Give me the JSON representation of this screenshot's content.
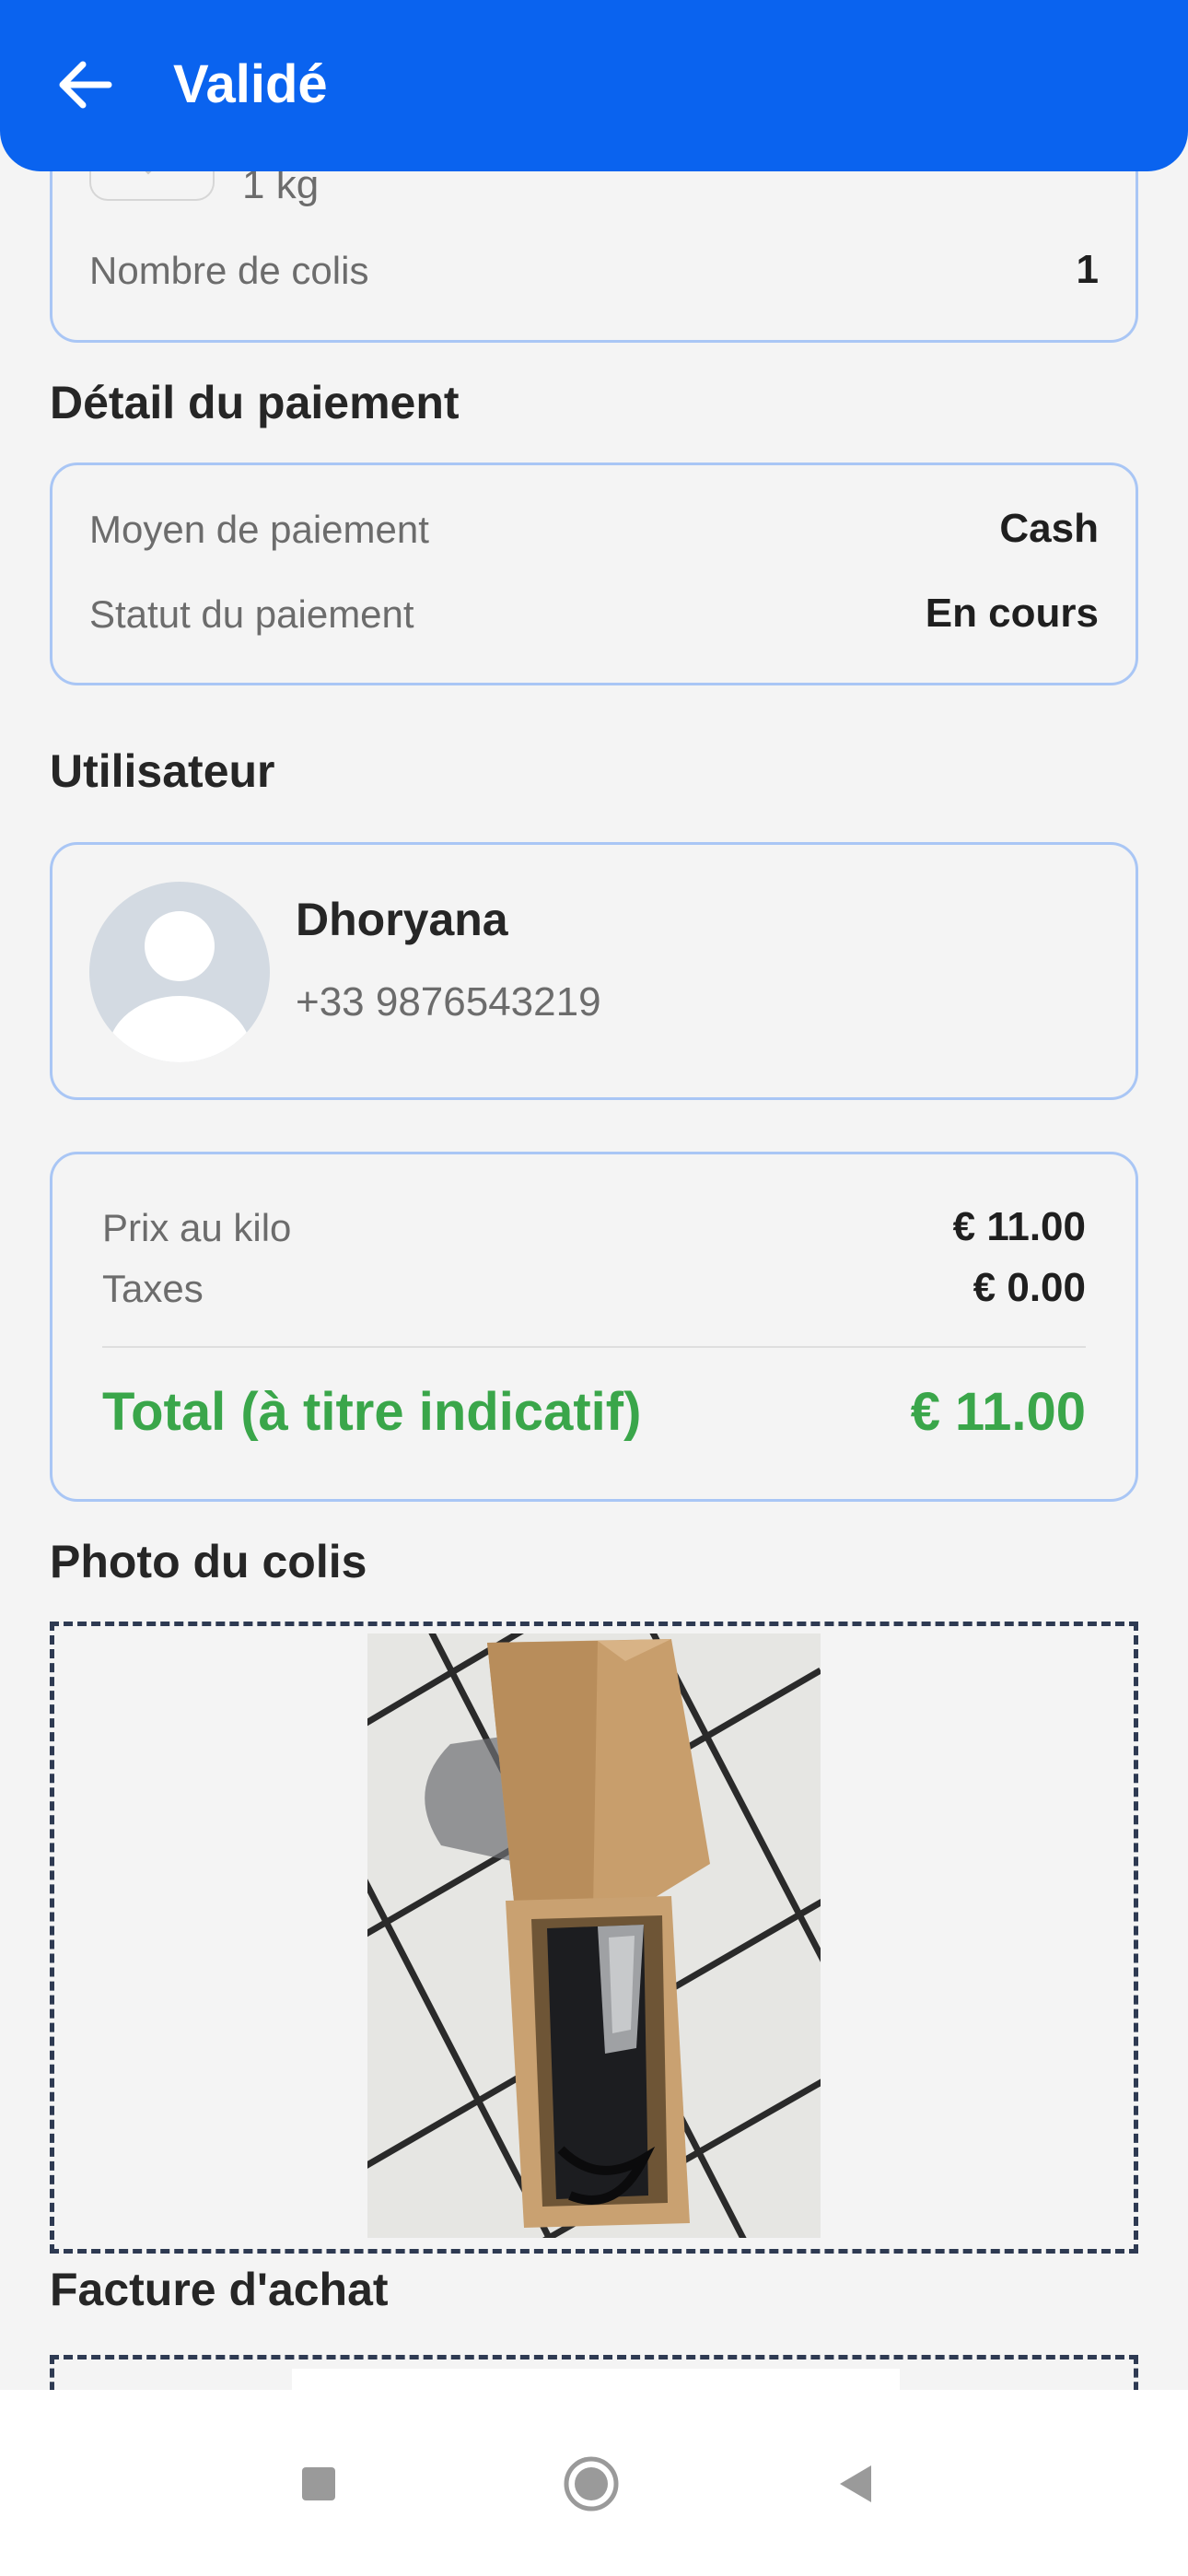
{
  "header": {
    "title": "Validé"
  },
  "package": {
    "weight": "1 kg",
    "count_label": "Nombre de colis",
    "count_value": "1"
  },
  "payment": {
    "section_title": "Détail du paiement",
    "method_label": "Moyen de paiement",
    "method_value": "Cash",
    "status_label": "Statut du paiement",
    "status_value": "En cours"
  },
  "user": {
    "section_title": "Utilisateur",
    "name": "Dhoryana",
    "phone": "+33 9876543219"
  },
  "pricing": {
    "per_kilo_label": "Prix au kilo",
    "per_kilo_value": "€ 11.00",
    "taxes_label": "Taxes",
    "taxes_value": "€ 0.00",
    "total_label": "Total (à titre indicatif)",
    "total_value": "€ 11.00"
  },
  "photo": {
    "section_title": "Photo du colis"
  },
  "invoice": {
    "section_title": "Facture d'achat"
  },
  "colors": {
    "primary": "#0a63ef",
    "accent_green": "#3aa64a",
    "card_border": "#a9c6f5"
  },
  "nav": {
    "icons": [
      "square-recents-icon",
      "circle-home-icon",
      "triangle-back-icon"
    ]
  }
}
